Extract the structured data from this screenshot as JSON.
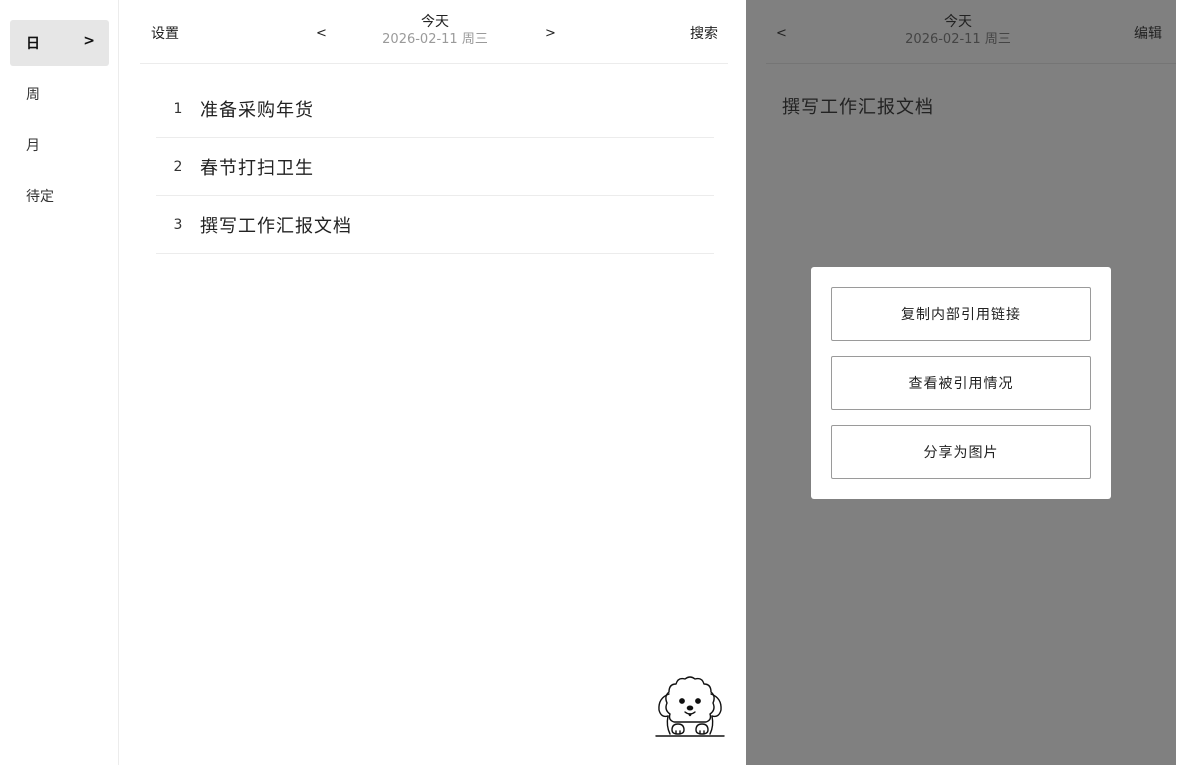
{
  "sidebar": {
    "items": [
      {
        "label": "日",
        "active": true,
        "chevron": ">"
      },
      {
        "label": "周"
      },
      {
        "label": "月"
      },
      {
        "label": "待定"
      }
    ]
  },
  "main": {
    "header": {
      "settings_label": "设置",
      "prev": "<",
      "title": "今天",
      "date": "2026-02-11 周三",
      "next": ">",
      "search_label": "搜索"
    },
    "tasks": [
      {
        "index": "1",
        "text": "准备采购年货"
      },
      {
        "index": "2",
        "text": "春节打扫卫生"
      },
      {
        "index": "3",
        "text": "撰写工作汇报文档"
      }
    ],
    "mascot": "dog-mascot-icon"
  },
  "detail": {
    "header": {
      "prev": "<",
      "title": "今天",
      "date": "2026-02-11 周三",
      "edit_label": "编辑"
    },
    "doc_title": "撰写工作汇报文档",
    "overlay_color": "#808080"
  },
  "menu": {
    "items": [
      {
        "label": "复制内部引用链接"
      },
      {
        "label": "查看被引用情况"
      },
      {
        "label": "分享为图片"
      }
    ]
  }
}
